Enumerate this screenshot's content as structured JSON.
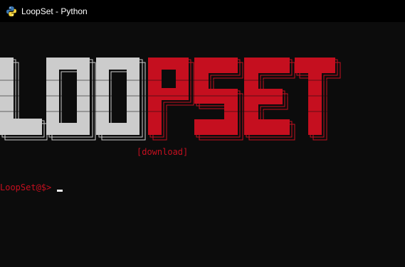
{
  "window": {
    "title": "LoopSet - Python"
  },
  "banner": {
    "art_text": "LOOPSET",
    "letters": [
      {
        "char": "L",
        "color": "#cccccc"
      },
      {
        "char": "O",
        "color": "#cccccc"
      },
      {
        "char": "O",
        "color": "#cccccc"
      },
      {
        "char": "P",
        "color": "#c50f1f"
      },
      {
        "char": "S",
        "color": "#c50f1f"
      },
      {
        "char": "E",
        "color": "#c50f1f"
      },
      {
        "char": "T",
        "color": "#c50f1f"
      }
    ]
  },
  "console": {
    "download_label": "[download]",
    "prompt": "LoopSet@$>",
    "input_value": ""
  },
  "colors": {
    "background": "#0c0c0c",
    "titlebar": "#000000",
    "accent_red": "#c50f1f",
    "art_gray": "#cccccc"
  },
  "icons": {
    "app": "python-icon"
  }
}
